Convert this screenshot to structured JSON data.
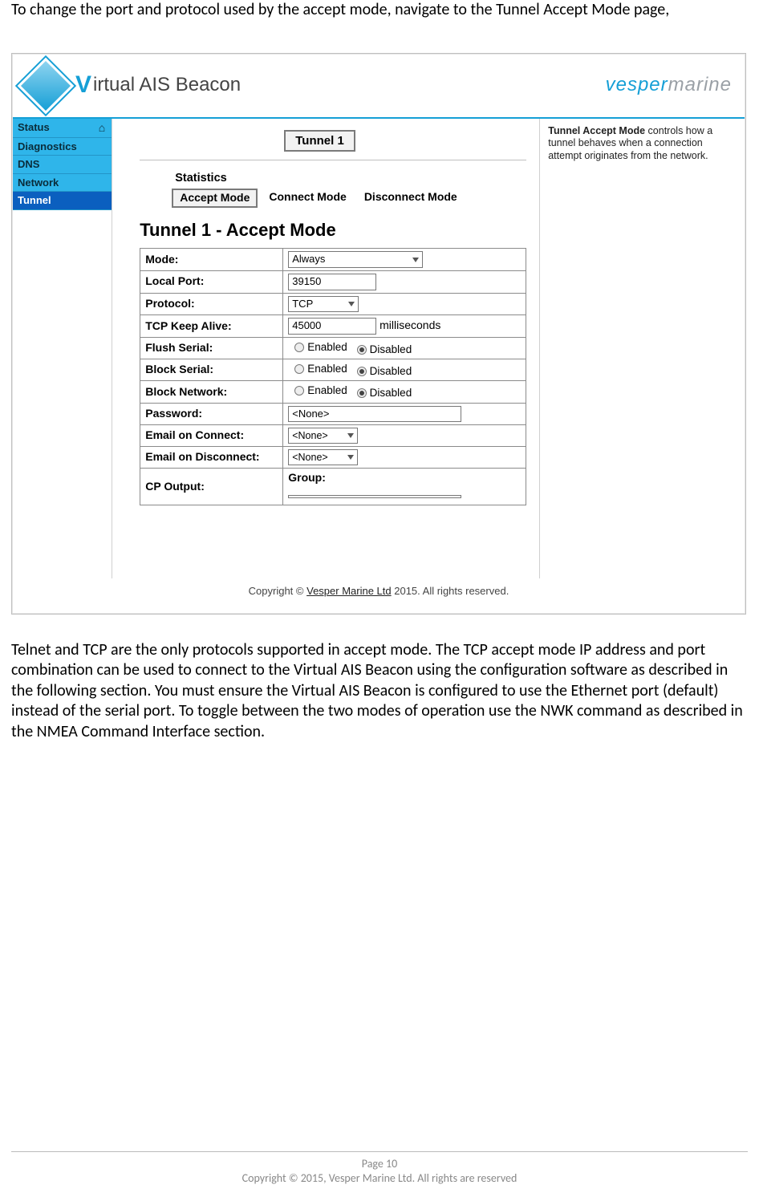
{
  "intro": "To change the port and protocol used by the accept mode, navigate to the Tunnel Accept Mode page,",
  "outro": "Telnet and TCP are the only protocols supported in accept mode. The TCP accept mode IP address and port combination can be used to connect to the Virtual AIS Beacon using the configuration software as described in the following section. You must ensure the Virtual AIS Beacon is configured to use the Ethernet port (default) instead of the serial port. To toggle between the two modes of operation use the NWK command as described in the NMEA Command Interface section.",
  "header": {
    "product_first": "V",
    "product_rest": "irtual AIS Beacon",
    "brand1": "vesper",
    "brand2": "marine"
  },
  "nav": {
    "items": [
      "Status",
      "Diagnostics",
      "DNS",
      "Network",
      "Tunnel"
    ],
    "active_index": 4
  },
  "tabs": {
    "tunnel_label": "Tunnel 1",
    "statistics_label": "Statistics",
    "modes": [
      "Accept Mode",
      "Connect Mode",
      "Disconnect Mode"
    ],
    "active_mode_index": 0
  },
  "section_title": "Tunnel 1 - Accept Mode",
  "help": {
    "bold": "Tunnel Accept Mode",
    "text": " controls how a tunnel behaves when a connection attempt originates from the network."
  },
  "form": {
    "mode": {
      "label": "Mode:",
      "value": "Always"
    },
    "local_port": {
      "label": "Local Port:",
      "value": "39150"
    },
    "protocol": {
      "label": "Protocol:",
      "value": "TCP"
    },
    "keep_alive": {
      "label": "TCP Keep Alive:",
      "value": "45000",
      "unit": "milliseconds"
    },
    "flush_serial": {
      "label": "Flush Serial:",
      "enabled": "Enabled",
      "disabled": "Disabled",
      "selected": "disabled"
    },
    "block_serial": {
      "label": "Block Serial:",
      "enabled": "Enabled",
      "disabled": "Disabled",
      "selected": "disabled"
    },
    "block_network": {
      "label": "Block Network:",
      "enabled": "Enabled",
      "disabled": "Disabled",
      "selected": "disabled"
    },
    "password": {
      "label": "Password:",
      "value": "<None>"
    },
    "email_connect": {
      "label": "Email on Connect:",
      "value": "<None>"
    },
    "email_disconnect": {
      "label": "Email on Disconnect:",
      "value": "<None>"
    },
    "cp_output": {
      "label": "CP Output:",
      "group_label": "Group:",
      "group_value": ""
    }
  },
  "inner_footer": {
    "pre": "Copyright © ",
    "link": "Vesper Marine Ltd",
    "post": " 2015. All rights reserved."
  },
  "page_footer": {
    "line1": "Page 10",
    "line2": "Copyright © 2015, Vesper Marine Ltd. All rights are reserved"
  }
}
